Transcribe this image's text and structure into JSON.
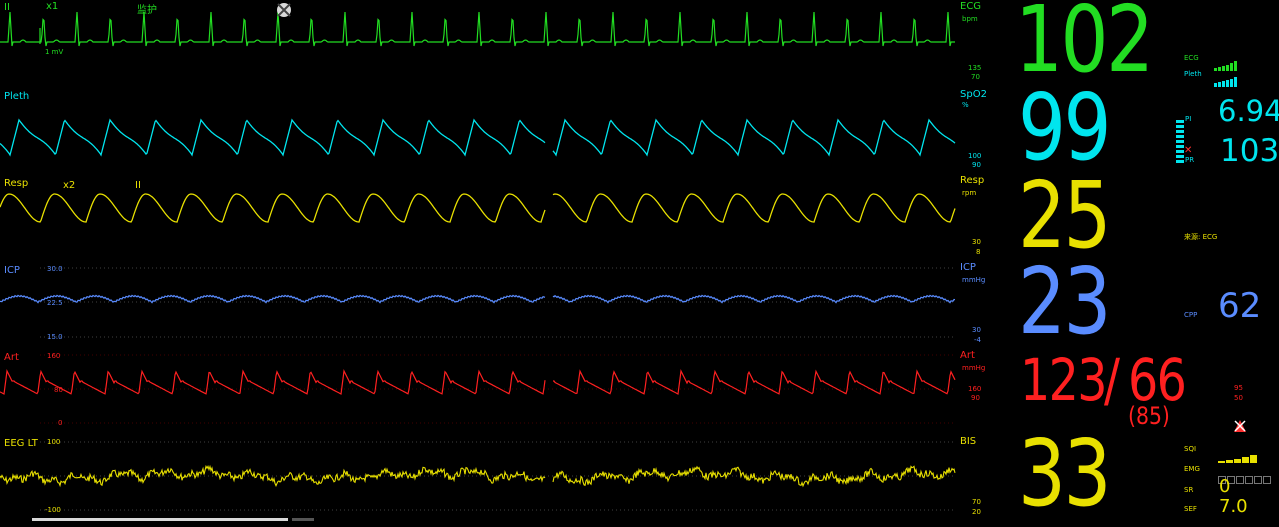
{
  "colors": {
    "ecg": "#22dd22",
    "spo2": "#00e5ee",
    "resp": "#e8e000",
    "icp": "#5a8cff",
    "art": "#ff2020",
    "eeg": "#e8e000",
    "grid": "#6b6b00"
  },
  "ecg": {
    "lead": "II",
    "gain": "x1",
    "mode": "监护",
    "scale_label": "1 mV",
    "param_label": "ECG",
    "unit": "bpm",
    "alarm_high": "135",
    "alarm_low": "70",
    "value": "102",
    "alarm_off_icon": "alarm-off-icon"
  },
  "pleth": {
    "label": "Pleth",
    "param_label": "SpO2",
    "unit": "%",
    "alarm_high": "100",
    "alarm_low": "90",
    "value": "99",
    "pi_label": "PI",
    "pi_value": "6.94",
    "pr_label": "PR",
    "pr_value": "103"
  },
  "resp": {
    "label": "Resp",
    "gain": "x2",
    "lead": "II",
    "param_label": "Resp",
    "unit": "rpm",
    "alarm_high": "30",
    "alarm_low": "8",
    "value": "25",
    "source": "来源: ECG"
  },
  "icp": {
    "label": "ICP",
    "scale_top": "30.0",
    "scale_mid": "22.5",
    "scale_bottom": "15.0",
    "param_label": "ICP",
    "unit": "mmHg",
    "alarm_high": "30",
    "alarm_low": "-4",
    "value": "23",
    "cpp_label": "CPP",
    "cpp_value": "62"
  },
  "art": {
    "label": "Art",
    "scale_top": "160",
    "scale_mid": "80",
    "scale_bottom": "0",
    "param_label": "Art",
    "unit": "mmHg",
    "alarm_high": "160",
    "alarm_low": "90",
    "sys": "123",
    "separator": "/",
    "dia": "66",
    "mean": "(85)",
    "mean_alarm_high": "95",
    "mean_alarm_low": "50"
  },
  "eeg": {
    "label": "EEG LT",
    "scale_top": "100",
    "scale_bottom": "-100",
    "param_label": "BIS",
    "alarm_high": "70",
    "alarm_low": "20",
    "value": "33",
    "sqi_label": "SQI",
    "emg_label": "EMG",
    "sr_label": "SR",
    "sr_value": "0",
    "sef_label": "SEF",
    "sef_value": "7.0"
  },
  "signal_bars": {
    "ecg_label": "ECG",
    "pleth_label": "Pleth"
  }
}
